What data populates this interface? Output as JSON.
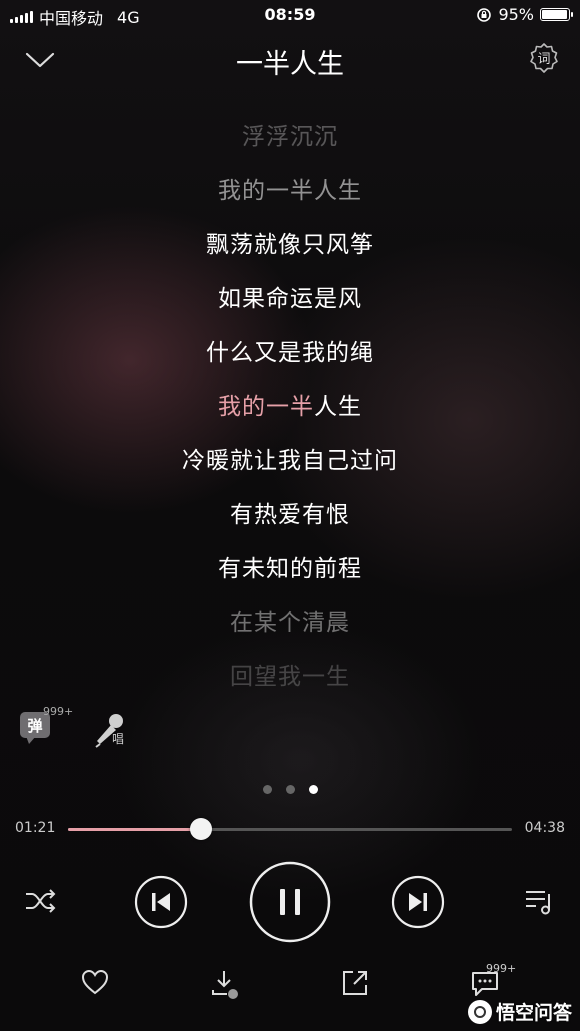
{
  "status_bar": {
    "carrier": "中国移动",
    "network": "4G",
    "time": "08:59",
    "battery": "95%",
    "battery_level": 0.95
  },
  "header": {
    "title": "一半人生",
    "lyric_button": "词"
  },
  "lyrics": [
    {
      "text": "浮浮沉沉",
      "style": "f1"
    },
    {
      "text": "我的一半人生",
      "style": "f2"
    },
    {
      "text": "飘荡就像只风筝",
      "style": ""
    },
    {
      "text": "如果命运是风",
      "style": ""
    },
    {
      "text": "什么又是我的绳",
      "style": ""
    },
    {
      "text_sung": "我的一半",
      "text_rest": "人生",
      "style": "current"
    },
    {
      "text": "冷暖就让我自己过问",
      "style": ""
    },
    {
      "text": "有热爱有恨",
      "style": ""
    },
    {
      "text": "有未知的前程",
      "style": ""
    },
    {
      "text": "在某个清晨",
      "style": "f3"
    },
    {
      "text": "回望我一生",
      "style": "f4"
    }
  ],
  "danmu": {
    "label": "弹",
    "count": "999+"
  },
  "sing": {
    "label": "唱"
  },
  "pager": {
    "count": 3,
    "active": 2
  },
  "progress": {
    "current": "01:21",
    "total": "04:38",
    "fraction": 0.3
  },
  "actions": {
    "comment_count": "999+"
  },
  "watermark": {
    "text": "悟空问答"
  },
  "colors": {
    "accent": "#e6a0a8",
    "background": "#0b0a0b",
    "text": "#ffffff"
  }
}
